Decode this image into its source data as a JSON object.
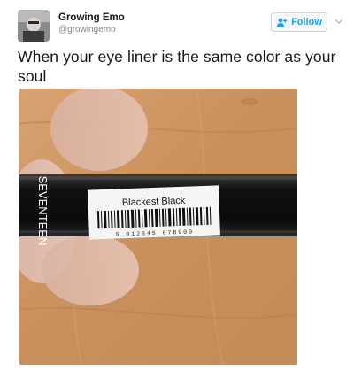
{
  "author": {
    "display_name": "Growing Emo",
    "handle": "@growingemo",
    "avatar_icon": "profile-photo"
  },
  "follow_button": {
    "label": "Follow",
    "icon": "follow-person-plus-icon"
  },
  "menu_icon": "chevron-down-icon",
  "tweet": {
    "text": "When your eye liner is the same color as your soul"
  },
  "photo": {
    "label_text": "Blackest Black",
    "brand_text": "SEVENTEEN",
    "barcode_text": "5 012345 678900"
  },
  "colors": {
    "accent": "#1da1f2",
    "text": "#14171a",
    "muted": "#7a8792",
    "wood": "#cf9a6a"
  }
}
